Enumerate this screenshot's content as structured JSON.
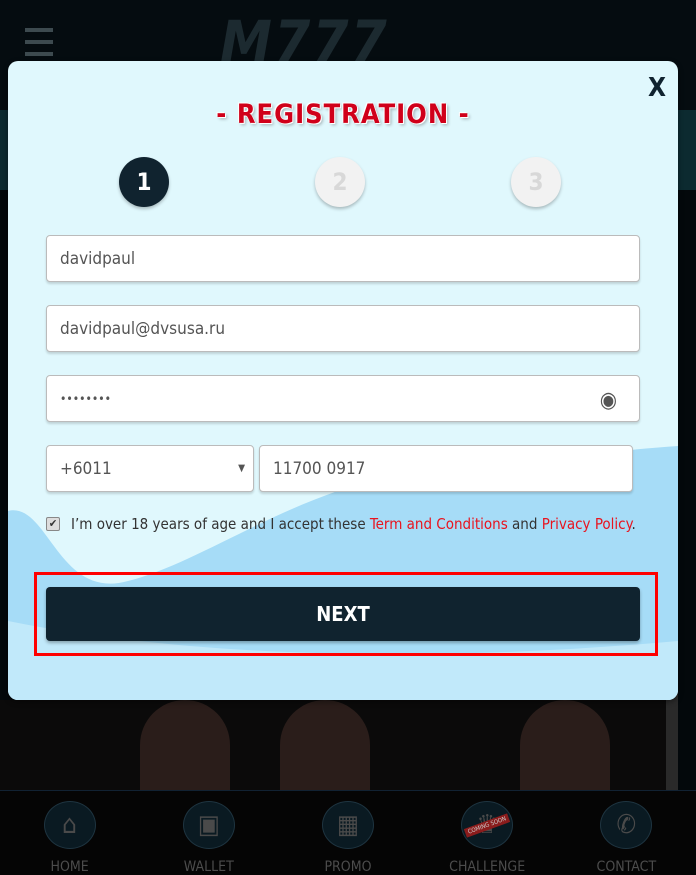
{
  "header": {
    "logo": "M777"
  },
  "modal": {
    "close_label": "X",
    "title": "- REGISTRATION -",
    "steps": [
      "1",
      "2",
      "3"
    ],
    "active_step": 1,
    "username_value": "davidpaul",
    "email_value": "davidpaul@dvsusa.ru",
    "password_value": "••••••••",
    "country_code": "+6011",
    "phone_value": "11700 0917",
    "agree_checked": true,
    "terms_text_1": "I’m over 18 years of age and I accept these ",
    "terms_link": "Term and Conditions",
    "terms_text_2": " and ",
    "privacy_link": "Privacy Policy",
    "terms_text_3": ".",
    "next_label": "NEXT",
    "link_color": "#e8141f",
    "button_color": "#10232f"
  },
  "nav": [
    {
      "label": "HOME",
      "icon": "home-icon"
    },
    {
      "label": "WALLET",
      "icon": "wallet-icon"
    },
    {
      "label": "PROMO",
      "icon": "gift-icon"
    },
    {
      "label": "CHALLENGE",
      "icon": "trophy-icon",
      "badge": "COMING SOON"
    },
    {
      "label": "CONTACT",
      "icon": "phone-icon"
    }
  ]
}
